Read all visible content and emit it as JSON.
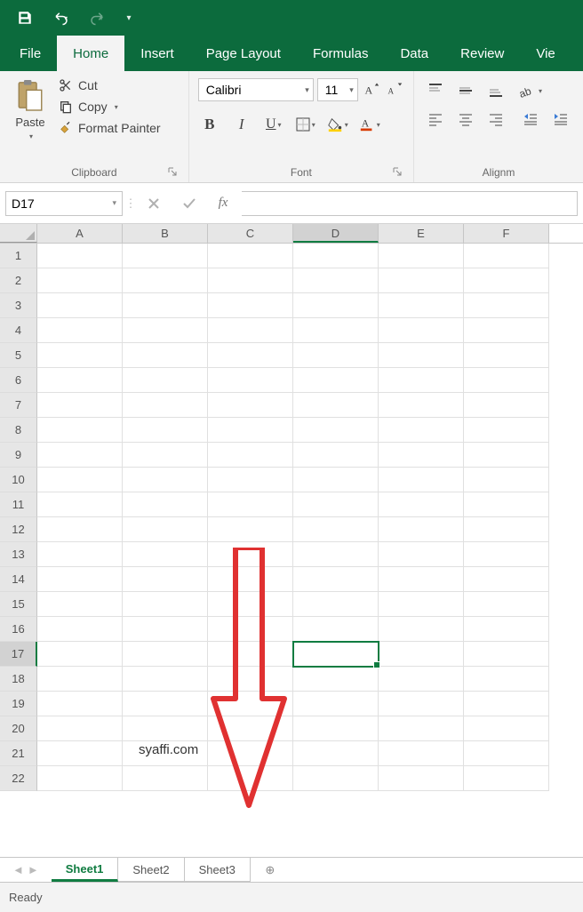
{
  "qat": {
    "save": "save",
    "undo": "undo",
    "redo": "redo"
  },
  "tabs": {
    "file": "File",
    "home": "Home",
    "insert": "Insert",
    "page_layout": "Page Layout",
    "formulas": "Formulas",
    "data": "Data",
    "review": "Review",
    "view": "Vie"
  },
  "ribbon": {
    "clipboard": {
      "paste": "Paste",
      "cut": "Cut",
      "copy": "Copy",
      "format_painter": "Format Painter",
      "label": "Clipboard"
    },
    "font": {
      "name": "Calibri",
      "size": "11",
      "label": "Font"
    },
    "alignment": {
      "label": "Alignm"
    }
  },
  "namebox": "D17",
  "fx_label": "fx",
  "columns": [
    "A",
    "B",
    "C",
    "D",
    "E",
    "F"
  ],
  "rows": [
    "1",
    "2",
    "3",
    "4",
    "5",
    "6",
    "7",
    "8",
    "9",
    "10",
    "11",
    "12",
    "13",
    "14",
    "15",
    "16",
    "17",
    "18",
    "19",
    "20",
    "21",
    "22"
  ],
  "selected": {
    "col": "D",
    "row": "17"
  },
  "sheets": {
    "s1": "Sheet1",
    "s2": "Sheet2",
    "s3": "Sheet3"
  },
  "status": "Ready",
  "watermark": "syaffi.com"
}
